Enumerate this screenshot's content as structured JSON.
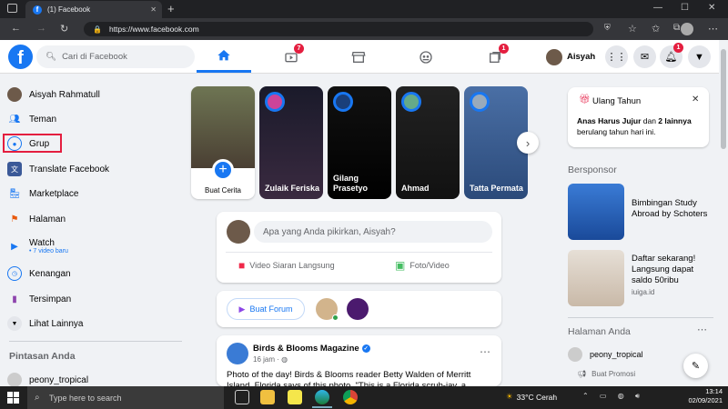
{
  "browser": {
    "tab_title": "(1) Facebook",
    "url": "https://www.facebook.com"
  },
  "header": {
    "search_placeholder": "Cari di Facebook",
    "watch_badge": "7",
    "pages_badge": "1",
    "notif_badge": "1",
    "profile_name": "Aisyah"
  },
  "left": {
    "items": [
      {
        "label": "Aisyah Rahmatull"
      },
      {
        "label": "Teman"
      },
      {
        "label": "Grup"
      },
      {
        "label": "Translate Facebook"
      },
      {
        "label": "Marketplace"
      },
      {
        "label": "Halaman"
      },
      {
        "label": "Watch",
        "sub": "• 7 video baru"
      },
      {
        "label": "Kenangan"
      },
      {
        "label": "Tersimpan"
      },
      {
        "label": "Lihat Lainnya"
      }
    ],
    "shortcuts_title": "Pintasan Anda",
    "shortcut_1": "peony_tropical"
  },
  "stories": [
    {
      "name": "Buat Cerita"
    },
    {
      "name": "Zulaik Feriska"
    },
    {
      "name": "Gilang Prasetyo"
    },
    {
      "name": "Ahmad"
    },
    {
      "name": "Tatta Permata"
    }
  ],
  "composer": {
    "placeholder": "Apa yang Anda pikirkan, Aisyah?",
    "live_label": "Video Siaran Langsung",
    "photo_label": "Foto/Video"
  },
  "rooms": {
    "create_label": "Buat Forum"
  },
  "post": {
    "page_name": "Birds & Blooms Magazine",
    "time": "16 jam · ",
    "text": "Photo of the day! Birds & Blooms reader Betty Walden of Merritt Island, Florida says of this photo, \"This is a Florida scrub-jay, a"
  },
  "right": {
    "birthday_title": "Ulang Tahun",
    "birthday_text_bold1": "Anas Harus Jujur",
    "birthday_text_mid": " dan ",
    "birthday_text_bold2": "2 lainnya",
    "birthday_text_end": "berulang tahun hari ini.",
    "sponsored_title": "Bersponsor",
    "ad1_title": "Bimbingan Study Abroad by Schoters",
    "ad2_title": "Daftar sekarang! Langsung dapat saldo 50ribu",
    "ad2_domain": "iuiga.id",
    "pages_title": "Halaman Anda",
    "page_name": "peony_tropical",
    "promote_label": "Buat Promosi"
  },
  "taskbar": {
    "search_placeholder": "Type here to search",
    "weather": "33°C  Cerah",
    "time": "13:14",
    "date": "02/09/2021"
  }
}
